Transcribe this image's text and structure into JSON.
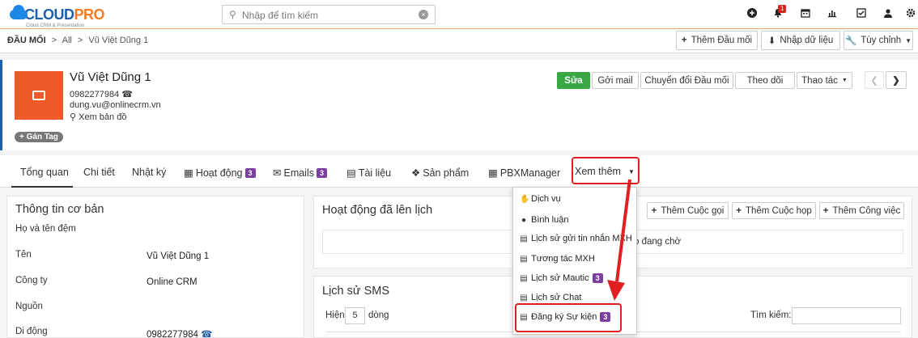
{
  "app": {
    "logo_main": "CLOUD",
    "logo_accent": "PRO",
    "logo_sub": "Cloud CRM & Presentation"
  },
  "search": {
    "placeholder": "Nhập để tìm kiếm"
  },
  "topbar": {
    "notification_count": "1"
  },
  "breadcrumb": {
    "module": "ĐẦU MỐI",
    "sep1": ">",
    "all": "All",
    "sep2": ">",
    "record": "Vũ Việt Dũng 1"
  },
  "header_actions": {
    "add": "Thêm Đầu mối",
    "import": "Nhập dữ liệu",
    "customize": "Tùy chỉnh"
  },
  "record": {
    "name": "Vũ Việt Dũng 1",
    "phone": "0982277984",
    "email": "dung.vu@onlinecrm.vn",
    "map": "Xem bản đồ",
    "tag_button": "Gán Tag"
  },
  "record_actions": {
    "edit": "Sửa",
    "send_mail": "Gởi mail",
    "convert": "Chuyển đổi Đầu mối",
    "follow": "Theo dõi",
    "actions": "Thao tác"
  },
  "tabs": [
    {
      "label": "Tổng quan"
    },
    {
      "label": "Chi tiết"
    },
    {
      "label": "Nhật ký"
    },
    {
      "label": "Hoạt động",
      "badge": "3"
    },
    {
      "label": "Emails",
      "badge": "3"
    },
    {
      "label": "Tài liệu"
    },
    {
      "label": "Sản phẩm"
    },
    {
      "label": "PBXManager"
    },
    {
      "label": "Xem thêm"
    }
  ],
  "basic_info": {
    "title": "Thông tin cơ bản",
    "rows": [
      {
        "label": "Họ và tên đệm",
        "value": ""
      },
      {
        "label": "Tên",
        "value": "Vũ Việt Dũng 1"
      },
      {
        "label": "Công ty",
        "value": "Online CRM"
      },
      {
        "label": "Nguồn",
        "value": ""
      },
      {
        "label": "Di động",
        "value": "0982277984"
      }
    ]
  },
  "scheduled": {
    "title": "Hoạt động đã lên lịch",
    "add_call": "Thêm Cuộc gọi",
    "add_meeting": "Thêm Cuộc họp",
    "add_task": "Thêm Công việc",
    "empty_text": "o đang chờ"
  },
  "sms": {
    "title": "Lịch sử SMS",
    "show_label": "Hiện",
    "page_size": "5",
    "rows_label": "dòng",
    "search_label": "Tìm kiếm:"
  },
  "more_menu": {
    "items": [
      {
        "label": "Dịch vụ"
      },
      {
        "label": "Bình luận"
      },
      {
        "label": "Lịch sử gửi tin nhắn MXH"
      },
      {
        "label": "Tương tác MXH"
      },
      {
        "label": "Lịch sử Mautic",
        "badge": "3"
      },
      {
        "label": "Lịch sử Chat"
      },
      {
        "label": "Đăng ký Sự kiện",
        "badge": "3"
      }
    ]
  },
  "colors": {
    "accent": "#f05a28",
    "edit_green": "#3aa745",
    "badge_purple": "#7b3fa0",
    "highlight_red": "#e02020"
  }
}
